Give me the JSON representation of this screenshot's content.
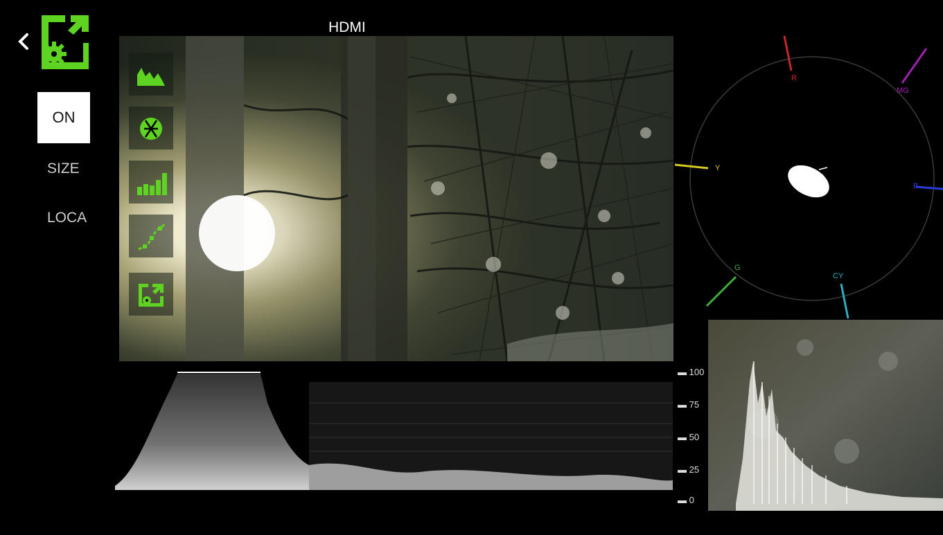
{
  "header": {
    "source_label": "HDMI"
  },
  "sidebar": {
    "back_icon": "chevron-left-icon",
    "overlay_settings_icon": "overlay-gear-icon",
    "on_label": "ON",
    "size_label": "SIZE",
    "location_label": "LOCA"
  },
  "tools": [
    {
      "icon": "histogram-tool-icon"
    },
    {
      "icon": "vectorscope-tool-icon"
    },
    {
      "icon": "bar-meter-tool-icon"
    },
    {
      "icon": "curve-tool-icon"
    },
    {
      "icon": "overlay-settings-tool-icon"
    }
  ],
  "vectorscope": {
    "labels": {
      "r": "R",
      "mg": "MG",
      "b": "B",
      "cy": "CY",
      "g": "G",
      "y": "Y"
    },
    "colors": {
      "r": "#c62828",
      "mg": "#a020b0",
      "b": "#2a3cd8",
      "cy": "#2ab0c0",
      "g": "#3bb23b",
      "y": "#d8c820"
    }
  },
  "waveform": {
    "scale": [
      "100",
      "75",
      "50",
      "25",
      "0"
    ]
  },
  "colors": {
    "accent": "#5fd321"
  }
}
